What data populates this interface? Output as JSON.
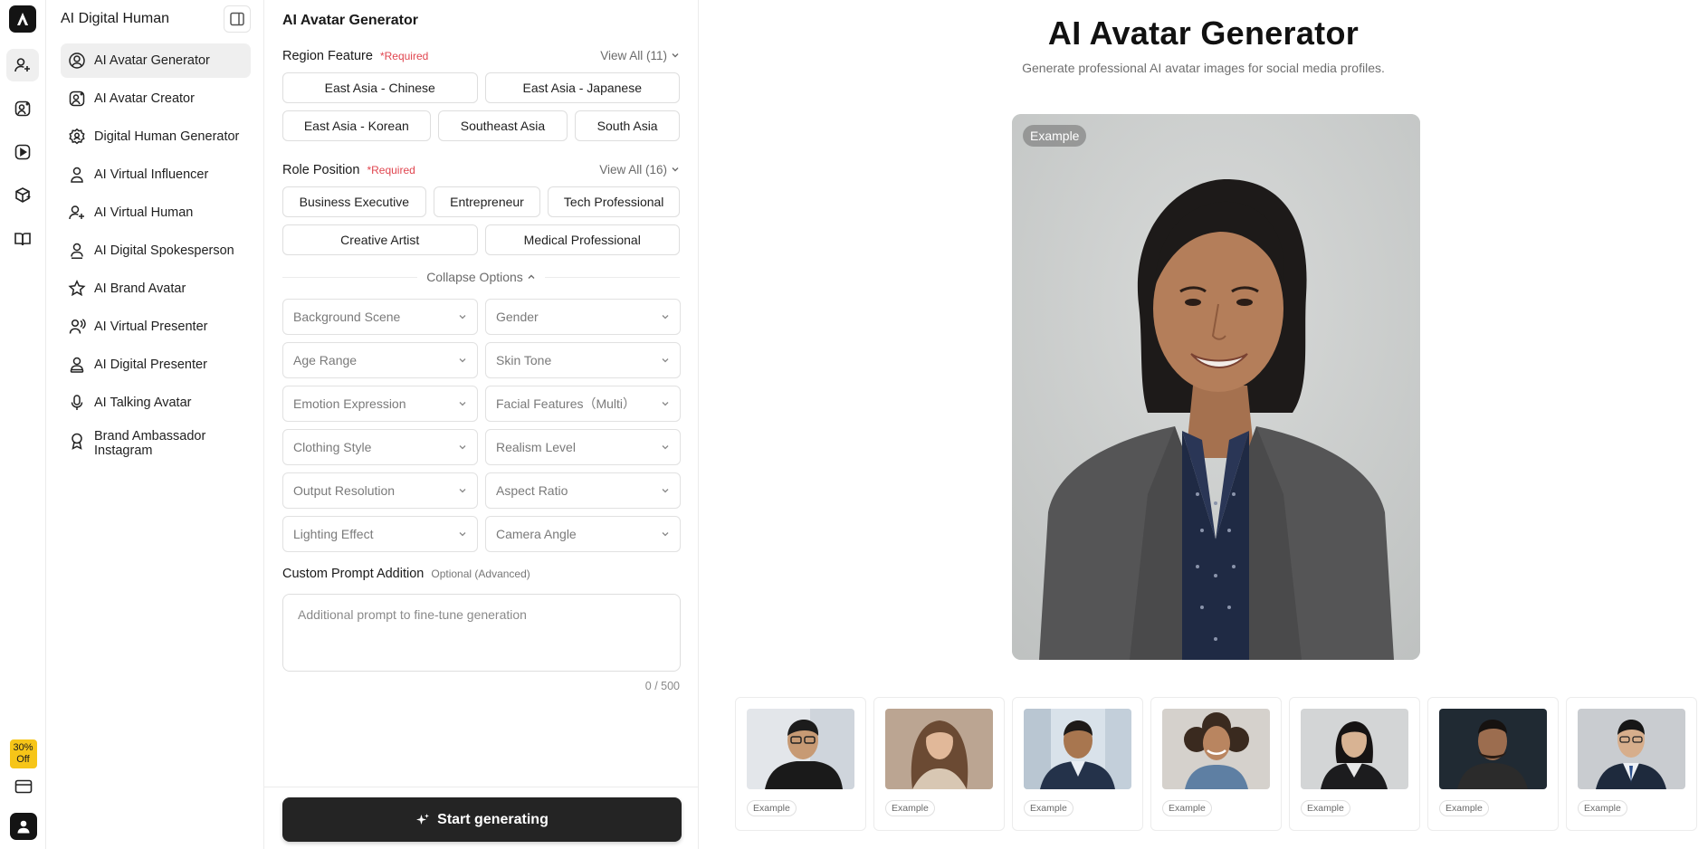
{
  "rail": {
    "promo_line1": "30%",
    "promo_line2": "Off",
    "icons": [
      "user-plus-icon",
      "user-sparkle-icon",
      "play-icon",
      "package-icon",
      "book-icon"
    ]
  },
  "sidebar": {
    "title": "AI Digital Human",
    "items": [
      {
        "label": "AI Avatar Generator",
        "icon": "user-circle-icon",
        "active": true
      },
      {
        "label": "AI Avatar Creator",
        "icon": "user-sparkle-icon"
      },
      {
        "label": "Digital Human Generator",
        "icon": "gear-user-icon"
      },
      {
        "label": "AI Virtual Influencer",
        "icon": "user-stand-icon"
      },
      {
        "label": "AI Virtual Human",
        "icon": "user-plus-icon"
      },
      {
        "label": "AI Digital Spokesperson",
        "icon": "user-stand-icon"
      },
      {
        "label": "AI Brand Avatar",
        "icon": "star-person-icon"
      },
      {
        "label": "AI Virtual Presenter",
        "icon": "presenter-icon"
      },
      {
        "label": "AI Digital Presenter",
        "icon": "user-stand-icon"
      },
      {
        "label": "AI Talking Avatar",
        "icon": "microphone-icon"
      },
      {
        "label_line1": "Brand Ambassador",
        "label_line2": "Instagram",
        "icon": "award-icon"
      }
    ]
  },
  "panel": {
    "title": "AI Avatar Generator",
    "region": {
      "label": "Region Feature",
      "required": "*Required",
      "view_all": "View All (11)",
      "chips_row1": [
        "East Asia - Chinese",
        "East Asia - Japanese"
      ],
      "chips_row2": [
        "East Asia - Korean",
        "Southeast Asia",
        "South Asia"
      ]
    },
    "role": {
      "label": "Role Position",
      "required": "*Required",
      "view_all": "View All (16)",
      "chips_row1": [
        "Business Executive",
        "Entrepreneur",
        "Tech Professional"
      ],
      "chips_row2": [
        "Creative Artist",
        "Medical Professional"
      ]
    },
    "collapse_label": "Collapse Options",
    "selects": [
      "Background Scene",
      "Gender",
      "Age Range",
      "Skin Tone",
      "Emotion Expression",
      "Facial Features（Multi）",
      "Clothing Style",
      "Realism Level",
      "Output Resolution",
      "Aspect Ratio",
      "Lighting Effect",
      "Camera Angle"
    ],
    "custom": {
      "label": "Custom Prompt Addition",
      "optional": "Optional (Advanced)",
      "placeholder": "Additional prompt to fine-tune generation",
      "counter": "0 / 500"
    },
    "generate_label": "Start generating"
  },
  "preview": {
    "title": "AI Avatar Generator",
    "subtitle": "Generate professional AI avatar images for social media profiles.",
    "badge": "Example",
    "thumb_tag": "Example",
    "thumbs": [
      {
        "name": "man-black-shirt-glasses"
      },
      {
        "name": "woman-long-brown-hair"
      },
      {
        "name": "man-suit-office"
      },
      {
        "name": "woman-curly-hair-denim"
      },
      {
        "name": "woman-black-blazer"
      },
      {
        "name": "man-beard-dark"
      },
      {
        "name": "man-suit-glasses"
      }
    ]
  }
}
